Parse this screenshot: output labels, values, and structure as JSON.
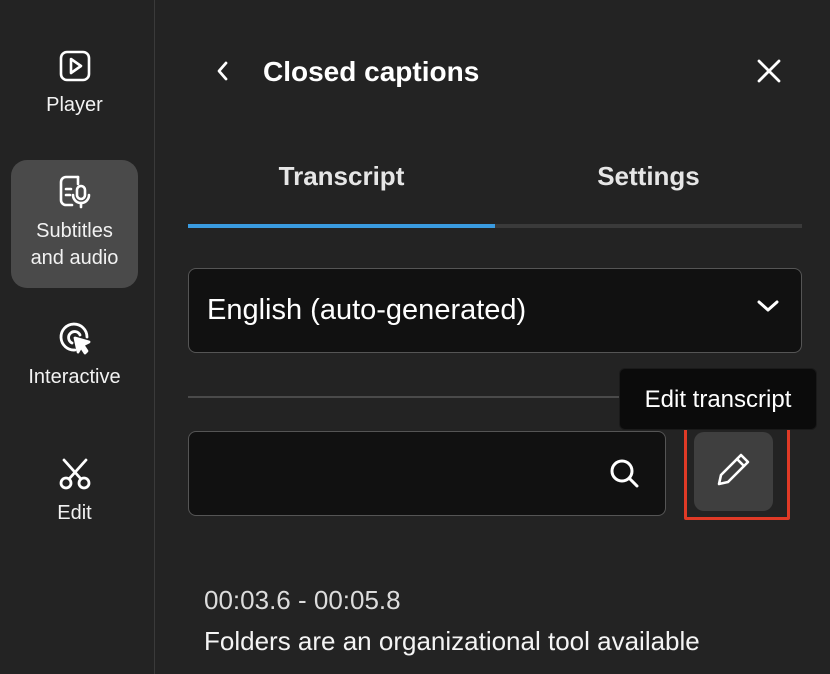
{
  "rail": {
    "items": [
      {
        "label": "Player",
        "icon": "play-square-icon",
        "active": false
      },
      {
        "label": "Subtitles\nand audio",
        "icon": "subtitles-mic-icon",
        "active": true
      },
      {
        "label": "Interactive",
        "icon": "cursor-click-icon",
        "active": false
      },
      {
        "label": "Edit",
        "icon": "scissors-icon",
        "active": false
      }
    ]
  },
  "panel": {
    "title": "Closed captions",
    "tabs": [
      {
        "label": "Transcript",
        "active": true
      },
      {
        "label": "Settings",
        "active": false
      }
    ],
    "language_select": {
      "value": "English (auto-generated)"
    },
    "search": {
      "value": "",
      "placeholder": ""
    },
    "tooltip": "Edit transcript",
    "cues": [
      {
        "time": "00:03.6 - 00:05.8",
        "text": "Folders are an organizational tool available"
      }
    ]
  },
  "colors": {
    "background": "#232323",
    "accent_tab": "#3a9be0",
    "highlight_box": "#e03a26",
    "rail_active": "#4a4a4a"
  }
}
